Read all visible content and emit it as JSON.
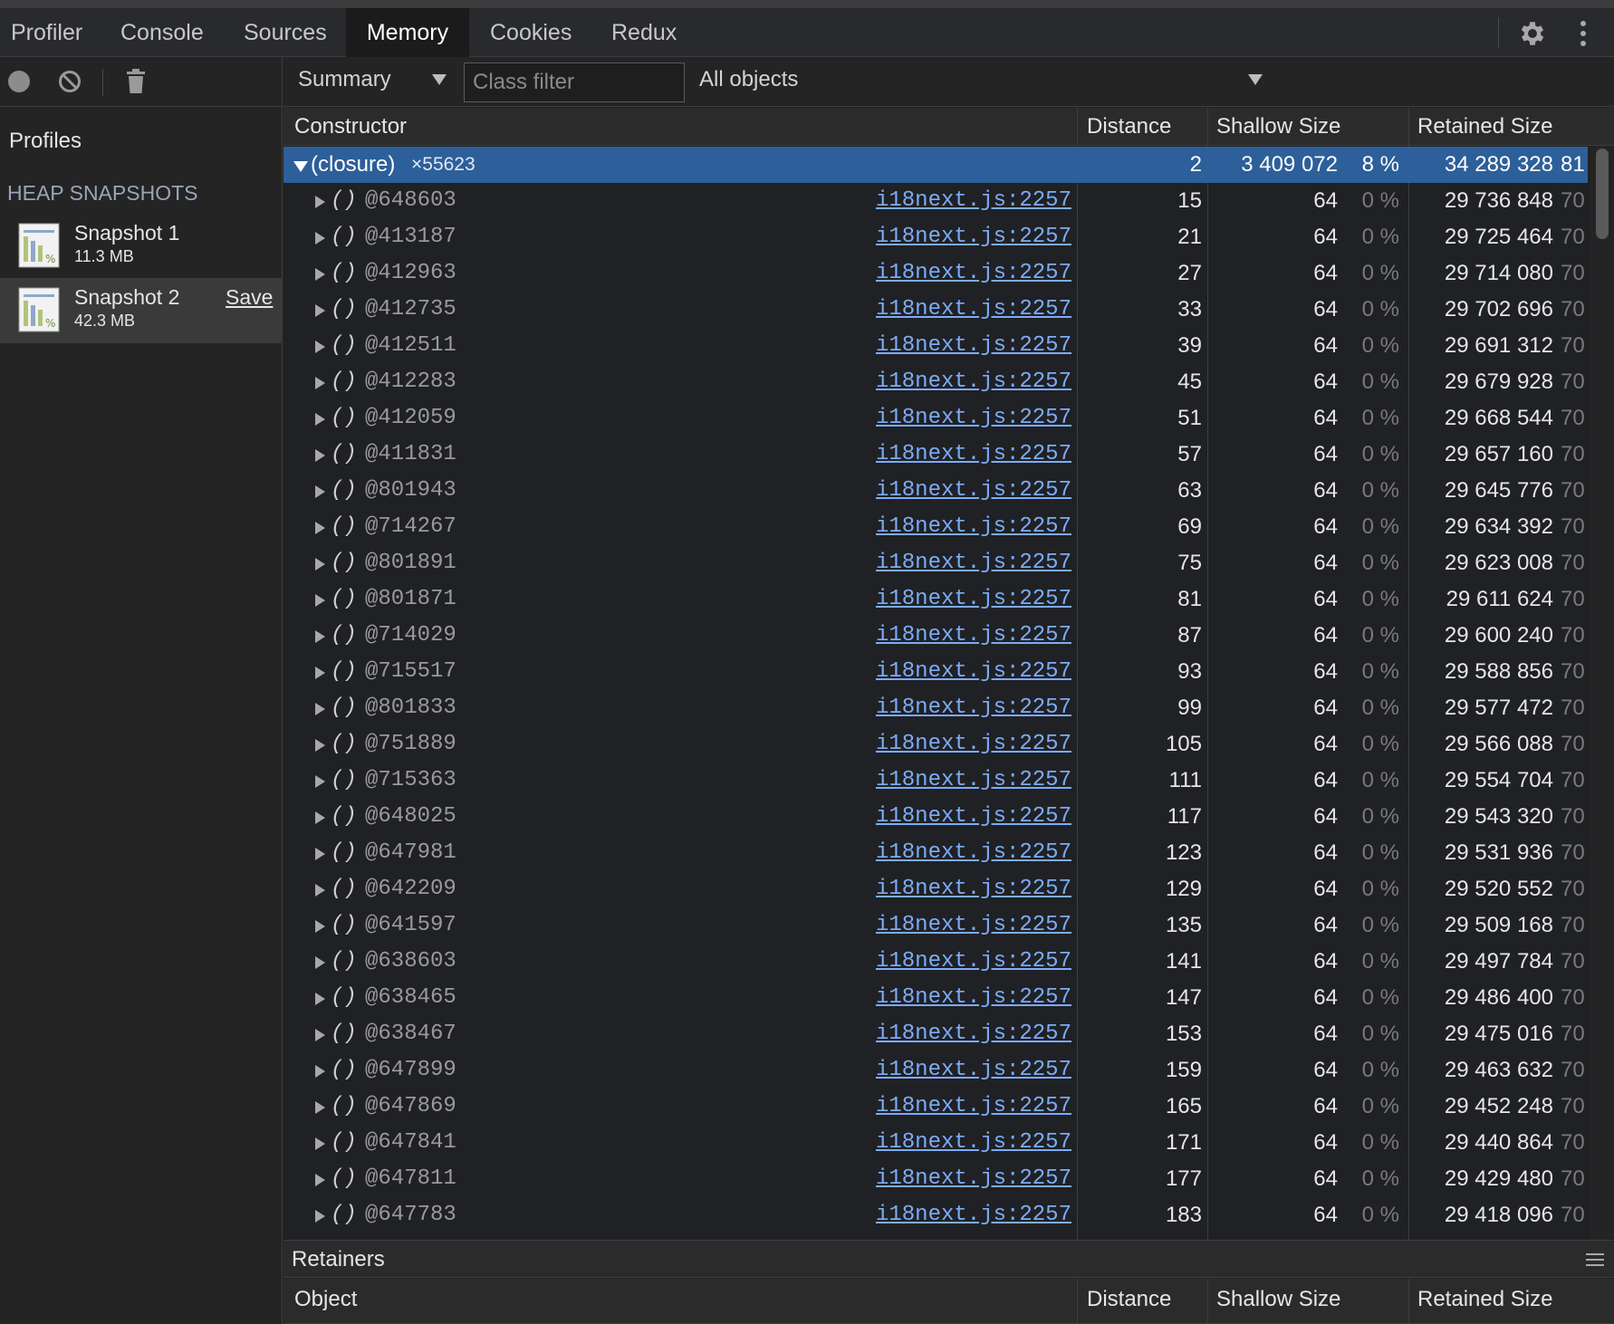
{
  "tabs": [
    {
      "label": "Profiler",
      "active": false
    },
    {
      "label": "Console",
      "active": false
    },
    {
      "label": "Sources",
      "active": false
    },
    {
      "label": "Memory",
      "active": true
    },
    {
      "label": "Cookies",
      "active": false
    },
    {
      "label": "Redux",
      "active": false
    }
  ],
  "icons": {
    "settings": "gear-icon",
    "more": "kebab-icon",
    "record": "record-icon",
    "clear": "clear-icon",
    "delete": "trash-icon",
    "snapshot": "heap-snapshot-icon",
    "expand": "triangle-right-icon",
    "collapse": "triangle-down-icon",
    "menu": "hamburger-icon"
  },
  "sidebar": {
    "profiles_label": "Profiles",
    "heap_label": "HEAP SNAPSHOTS",
    "snapshots": [
      {
        "name": "Snapshot 1",
        "size": "11.3 MB"
      },
      {
        "name": "Snapshot 2",
        "size": "42.3 MB",
        "action": "Save"
      }
    ]
  },
  "toolbar": {
    "view": "Summary",
    "class_filter_placeholder": "Class filter",
    "objects": "All objects"
  },
  "table": {
    "headers": {
      "constructor": "Constructor",
      "distance": "Distance",
      "shallow": "Shallow Size",
      "retained": "Retained Size"
    },
    "group": {
      "name": "(closure)",
      "count": "×55623",
      "distance": "2",
      "shallow": "3 409 072",
      "shallow_pct": "8 %",
      "retained": "34 289 328",
      "retained_pct": "81"
    },
    "rows": [
      {
        "name": "()",
        "id": "@648603",
        "link": "i18next.js:2257",
        "distance": "15",
        "shallow": "64",
        "shallow_pct": "0 %",
        "retained": "29 736 848",
        "retained_pct": "70"
      },
      {
        "name": "()",
        "id": "@413187",
        "link": "i18next.js:2257",
        "distance": "21",
        "shallow": "64",
        "shallow_pct": "0 %",
        "retained": "29 725 464",
        "retained_pct": "70"
      },
      {
        "name": "()",
        "id": "@412963",
        "link": "i18next.js:2257",
        "distance": "27",
        "shallow": "64",
        "shallow_pct": "0 %",
        "retained": "29 714 080",
        "retained_pct": "70"
      },
      {
        "name": "()",
        "id": "@412735",
        "link": "i18next.js:2257",
        "distance": "33",
        "shallow": "64",
        "shallow_pct": "0 %",
        "retained": "29 702 696",
        "retained_pct": "70"
      },
      {
        "name": "()",
        "id": "@412511",
        "link": "i18next.js:2257",
        "distance": "39",
        "shallow": "64",
        "shallow_pct": "0 %",
        "retained": "29 691 312",
        "retained_pct": "70"
      },
      {
        "name": "()",
        "id": "@412283",
        "link": "i18next.js:2257",
        "distance": "45",
        "shallow": "64",
        "shallow_pct": "0 %",
        "retained": "29 679 928",
        "retained_pct": "70"
      },
      {
        "name": "()",
        "id": "@412059",
        "link": "i18next.js:2257",
        "distance": "51",
        "shallow": "64",
        "shallow_pct": "0 %",
        "retained": "29 668 544",
        "retained_pct": "70"
      },
      {
        "name": "()",
        "id": "@411831",
        "link": "i18next.js:2257",
        "distance": "57",
        "shallow": "64",
        "shallow_pct": "0 %",
        "retained": "29 657 160",
        "retained_pct": "70"
      },
      {
        "name": "()",
        "id": "@801943",
        "link": "i18next.js:2257",
        "distance": "63",
        "shallow": "64",
        "shallow_pct": "0 %",
        "retained": "29 645 776",
        "retained_pct": "70"
      },
      {
        "name": "()",
        "id": "@714267",
        "link": "i18next.js:2257",
        "distance": "69",
        "shallow": "64",
        "shallow_pct": "0 %",
        "retained": "29 634 392",
        "retained_pct": "70"
      },
      {
        "name": "()",
        "id": "@801891",
        "link": "i18next.js:2257",
        "distance": "75",
        "shallow": "64",
        "shallow_pct": "0 %",
        "retained": "29 623 008",
        "retained_pct": "70"
      },
      {
        "name": "()",
        "id": "@801871",
        "link": "i18next.js:2257",
        "distance": "81",
        "shallow": "64",
        "shallow_pct": "0 %",
        "retained": "29 611 624",
        "retained_pct": "70"
      },
      {
        "name": "()",
        "id": "@714029",
        "link": "i18next.js:2257",
        "distance": "87",
        "shallow": "64",
        "shallow_pct": "0 %",
        "retained": "29 600 240",
        "retained_pct": "70"
      },
      {
        "name": "()",
        "id": "@715517",
        "link": "i18next.js:2257",
        "distance": "93",
        "shallow": "64",
        "shallow_pct": "0 %",
        "retained": "29 588 856",
        "retained_pct": "70"
      },
      {
        "name": "()",
        "id": "@801833",
        "link": "i18next.js:2257",
        "distance": "99",
        "shallow": "64",
        "shallow_pct": "0 %",
        "retained": "29 577 472",
        "retained_pct": "70"
      },
      {
        "name": "()",
        "id": "@751889",
        "link": "i18next.js:2257",
        "distance": "105",
        "shallow": "64",
        "shallow_pct": "0 %",
        "retained": "29 566 088",
        "retained_pct": "70"
      },
      {
        "name": "()",
        "id": "@715363",
        "link": "i18next.js:2257",
        "distance": "111",
        "shallow": "64",
        "shallow_pct": "0 %",
        "retained": "29 554 704",
        "retained_pct": "70"
      },
      {
        "name": "()",
        "id": "@648025",
        "link": "i18next.js:2257",
        "distance": "117",
        "shallow": "64",
        "shallow_pct": "0 %",
        "retained": "29 543 320",
        "retained_pct": "70"
      },
      {
        "name": "()",
        "id": "@647981",
        "link": "i18next.js:2257",
        "distance": "123",
        "shallow": "64",
        "shallow_pct": "0 %",
        "retained": "29 531 936",
        "retained_pct": "70"
      },
      {
        "name": "()",
        "id": "@642209",
        "link": "i18next.js:2257",
        "distance": "129",
        "shallow": "64",
        "shallow_pct": "0 %",
        "retained": "29 520 552",
        "retained_pct": "70"
      },
      {
        "name": "()",
        "id": "@641597",
        "link": "i18next.js:2257",
        "distance": "135",
        "shallow": "64",
        "shallow_pct": "0 %",
        "retained": "29 509 168",
        "retained_pct": "70"
      },
      {
        "name": "()",
        "id": "@638603",
        "link": "i18next.js:2257",
        "distance": "141",
        "shallow": "64",
        "shallow_pct": "0 %",
        "retained": "29 497 784",
        "retained_pct": "70"
      },
      {
        "name": "()",
        "id": "@638465",
        "link": "i18next.js:2257",
        "distance": "147",
        "shallow": "64",
        "shallow_pct": "0 %",
        "retained": "29 486 400",
        "retained_pct": "70"
      },
      {
        "name": "()",
        "id": "@638467",
        "link": "i18next.js:2257",
        "distance": "153",
        "shallow": "64",
        "shallow_pct": "0 %",
        "retained": "29 475 016",
        "retained_pct": "70"
      },
      {
        "name": "()",
        "id": "@647899",
        "link": "i18next.js:2257",
        "distance": "159",
        "shallow": "64",
        "shallow_pct": "0 %",
        "retained": "29 463 632",
        "retained_pct": "70"
      },
      {
        "name": "()",
        "id": "@647869",
        "link": "i18next.js:2257",
        "distance": "165",
        "shallow": "64",
        "shallow_pct": "0 %",
        "retained": "29 452 248",
        "retained_pct": "70"
      },
      {
        "name": "()",
        "id": "@647841",
        "link": "i18next.js:2257",
        "distance": "171",
        "shallow": "64",
        "shallow_pct": "0 %",
        "retained": "29 440 864",
        "retained_pct": "70"
      },
      {
        "name": "()",
        "id": "@647811",
        "link": "i18next.js:2257",
        "distance": "177",
        "shallow": "64",
        "shallow_pct": "0 %",
        "retained": "29 429 480",
        "retained_pct": "70"
      },
      {
        "name": "()",
        "id": "@647783",
        "link": "i18next.js:2257",
        "distance": "183",
        "shallow": "64",
        "shallow_pct": "0 %",
        "retained": "29 418 096",
        "retained_pct": "70"
      }
    ]
  },
  "retainers": {
    "title": "Retainers",
    "headers": {
      "object": "Object",
      "distance": "Distance",
      "shallow": "Shallow Size",
      "retained": "Retained Size"
    }
  }
}
